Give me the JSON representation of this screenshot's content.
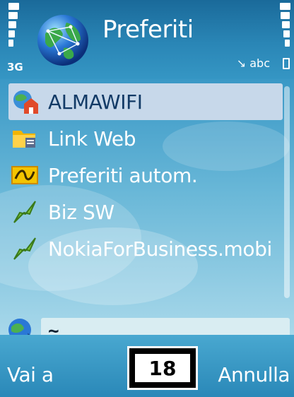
{
  "status": {
    "network": "3G",
    "input_mode": "abc"
  },
  "title": {
    "text": "Preferiti",
    "icon": "globe-network-icon"
  },
  "list": {
    "items": [
      {
        "label": "ALMAWIFI",
        "icon": "home-wifi-icon",
        "selected": true
      },
      {
        "label": "Link Web",
        "icon": "folder-icon",
        "selected": false
      },
      {
        "label": "Preferiti autom.",
        "icon": "auto-bookmarks-icon",
        "selected": false
      },
      {
        "label": "Biz SW",
        "icon": "bookmark-arrow-icon",
        "selected": false
      },
      {
        "label": "NokiaForBusiness.mobi",
        "icon": "bookmark-arrow-icon",
        "selected": false
      }
    ]
  },
  "address": {
    "value": "~",
    "icon": "globe-go-icon"
  },
  "softkeys": {
    "left": "Vai a",
    "right": "Annulla"
  },
  "badge": {
    "value": "18"
  },
  "colors": {
    "selection": "#c7d8ea",
    "selection_text": "#123a66",
    "background_top": "#1a6a9a",
    "background_bottom": "#a8d8ea"
  }
}
